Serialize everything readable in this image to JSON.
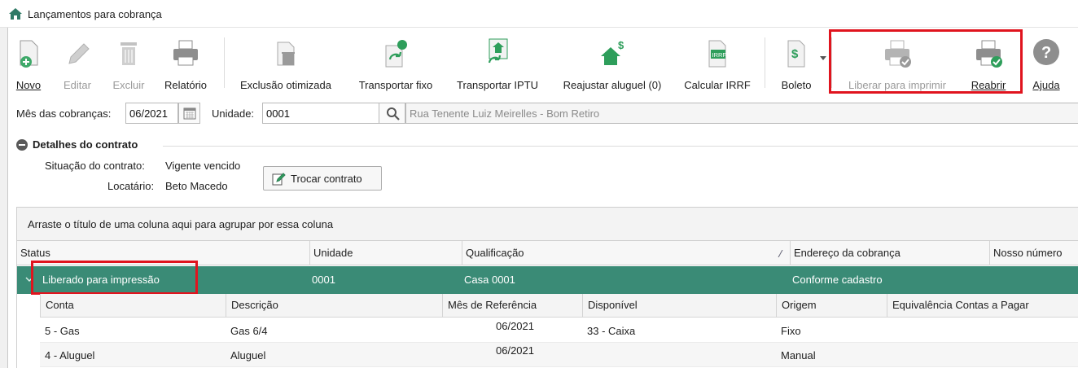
{
  "window": {
    "title": "Lançamentos para cobrança"
  },
  "toolbar": {
    "novo": "Novo",
    "editar": "Editar",
    "excluir": "Excluir",
    "relatorio": "Relatório",
    "exclusao_otimizada": "Exclusão otimizada",
    "transportar_fixo": "Transportar fixo",
    "transportar_iptu": "Transportar IPTU",
    "reajustar_aluguel": "Reajustar aluguel (0)",
    "calcular_irrf": "Calcular IRRF",
    "irrf_badge": "IRRF",
    "boleto": "Boleto",
    "liberar_para_imprimir": "Liberar para imprimir",
    "reabrir": "Reabrir",
    "ajuda": "Ajuda"
  },
  "filters": {
    "mes_label": "Mês das cobranças:",
    "mes_value": "06/2021",
    "unidade_label": "Unidade:",
    "unidade_value": "0001",
    "endereco": "Rua Tenente Luiz Meirelles - Bom Retiro"
  },
  "details": {
    "section_title": "Detalhes do contrato",
    "situacao_label": "Situação do contrato:",
    "situacao_value": "Vigente vencido",
    "locatario_label": "Locatário:",
    "locatario_value": "Beto Macedo",
    "trocar_contrato": "Trocar contrato"
  },
  "grid": {
    "group_hint": "Arraste o título de uma coluna aqui para agrupar por essa coluna",
    "columns": [
      "Status",
      "Unidade",
      "Qualificação",
      "Endereço da cobrança",
      "Nosso número"
    ],
    "row": {
      "status": "Liberado para impressão",
      "unidade": "0001",
      "qualificacao": "Casa 0001",
      "endereco": "Conforme cadastro"
    },
    "sub_columns": [
      "Conta",
      "Descrição",
      "Mês de Referência",
      "Disponível",
      "Origem",
      "Equivalência Contas a Pagar"
    ],
    "sub_rows": [
      {
        "conta": "5 - Gas",
        "descricao": "Gas 6/4",
        "mes": "06/2021",
        "disponivel": "33 - Caixa",
        "origem": "Fixo",
        "equivalencia": ""
      },
      {
        "conta": "4 - Aluguel",
        "descricao": "Aluguel",
        "mes": "06/2021",
        "disponivel": "",
        "origem": "Manual",
        "equivalencia": ""
      }
    ]
  },
  "colors": {
    "selected_row": "#3a8b76",
    "highlight": "#e0141e",
    "icon_green": "#2e9e5b",
    "icon_gray": "#8e8e8e"
  }
}
